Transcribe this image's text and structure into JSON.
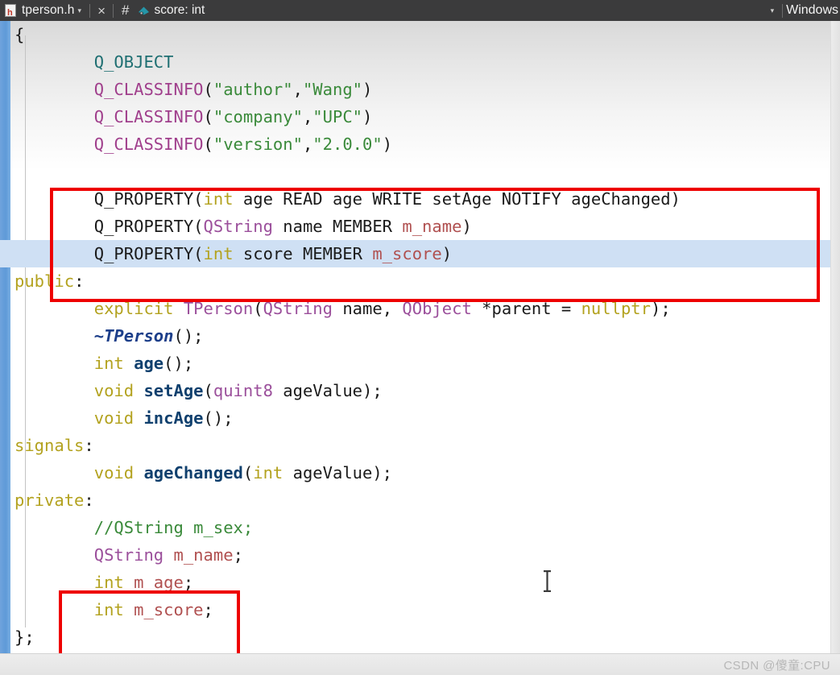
{
  "tabbar": {
    "file_icon": "header-file-icon",
    "file_name": "tperson.h",
    "caret": "▾",
    "close": "×",
    "hash": "#",
    "symbol_icon": "member-variable-icon",
    "symbol_label": "score: int",
    "right_caret": "▾",
    "right_label": "Windows"
  },
  "colors": {
    "tabbar_bg": "#3b3b3c",
    "highlight_line": "#cfe0f4",
    "annotation_red": "#ee0000",
    "gutter_blue": "#5e9ad8",
    "keyword": "#b3a21f",
    "type": "#9b4f9b",
    "macro": "#a03f8c",
    "qobject": "#1f6f72",
    "string": "#3a8a3a",
    "comment": "#3a8a3a",
    "function": "#10406e",
    "member": "#b05050",
    "watermark": "#b7b7b7"
  },
  "code": {
    "language": "C++ header",
    "lines": [
      {
        "n": 1,
        "highlight": false,
        "indent": 0,
        "tokens": [
          {
            "t": "{",
            "c": "plain"
          }
        ]
      },
      {
        "n": 2,
        "highlight": false,
        "indent": 4,
        "tokens": [
          {
            "t": "Q_OBJECT",
            "c": "qobj"
          }
        ]
      },
      {
        "n": 3,
        "highlight": false,
        "indent": 4,
        "tokens": [
          {
            "t": "Q_CLASSINFO",
            "c": "macro"
          },
          {
            "t": "(",
            "c": "plain"
          },
          {
            "t": "\"author\"",
            "c": "str"
          },
          {
            "t": ",",
            "c": "plain"
          },
          {
            "t": "\"Wang\"",
            "c": "str"
          },
          {
            "t": ")",
            "c": "plain"
          }
        ]
      },
      {
        "n": 4,
        "highlight": false,
        "indent": 4,
        "tokens": [
          {
            "t": "Q_CLASSINFO",
            "c": "macro"
          },
          {
            "t": "(",
            "c": "plain"
          },
          {
            "t": "\"company\"",
            "c": "str"
          },
          {
            "t": ",",
            "c": "plain"
          },
          {
            "t": "\"UPC\"",
            "c": "str"
          },
          {
            "t": ")",
            "c": "plain"
          }
        ]
      },
      {
        "n": 5,
        "highlight": false,
        "indent": 4,
        "tokens": [
          {
            "t": "Q_CLASSINFO",
            "c": "macro"
          },
          {
            "t": "(",
            "c": "plain"
          },
          {
            "t": "\"version\"",
            "c": "str"
          },
          {
            "t": ",",
            "c": "plain"
          },
          {
            "t": "\"2.0.0\"",
            "c": "str"
          },
          {
            "t": ")",
            "c": "plain"
          }
        ]
      },
      {
        "n": 6,
        "highlight": false,
        "indent": 0,
        "tokens": []
      },
      {
        "n": 7,
        "highlight": false,
        "indent": 4,
        "tokens": [
          {
            "t": "Q_PROPERTY",
            "c": "plain"
          },
          {
            "t": "(",
            "c": "plain"
          },
          {
            "t": "int",
            "c": "kw"
          },
          {
            "t": " age READ age WRITE setAge NOTIFY ageChanged",
            "c": "plain"
          },
          {
            "t": ")",
            "c": "plain"
          }
        ]
      },
      {
        "n": 8,
        "highlight": false,
        "indent": 4,
        "tokens": [
          {
            "t": "Q_PROPERTY",
            "c": "plain"
          },
          {
            "t": "(",
            "c": "plain"
          },
          {
            "t": "QString",
            "c": "type"
          },
          {
            "t": " name MEMBER ",
            "c": "plain"
          },
          {
            "t": "m_name",
            "c": "mem"
          },
          {
            "t": ")",
            "c": "plain"
          }
        ]
      },
      {
        "n": 9,
        "highlight": true,
        "indent": 4,
        "tokens": [
          {
            "t": "Q_PROPERTY",
            "c": "plain"
          },
          {
            "t": "(",
            "c": "plain"
          },
          {
            "t": "int",
            "c": "kw"
          },
          {
            "t": " score MEMBER ",
            "c": "plain"
          },
          {
            "t": "m_score",
            "c": "mem"
          },
          {
            "t": ")",
            "c": "plain"
          }
        ]
      },
      {
        "n": 10,
        "highlight": false,
        "indent": 0,
        "tokens": [
          {
            "t": "public",
            "c": "kw"
          },
          {
            "t": ":",
            "c": "plain"
          }
        ]
      },
      {
        "n": 11,
        "highlight": false,
        "indent": 4,
        "tokens": [
          {
            "t": "explicit",
            "c": "kw"
          },
          {
            "t": " ",
            "c": "plain"
          },
          {
            "t": "TPerson",
            "c": "type"
          },
          {
            "t": "(",
            "c": "plain"
          },
          {
            "t": "QString",
            "c": "type"
          },
          {
            "t": " name, ",
            "c": "plain"
          },
          {
            "t": "QObject",
            "c": "type"
          },
          {
            "t": " *parent = ",
            "c": "plain"
          },
          {
            "t": "nullptr",
            "c": "kw"
          },
          {
            "t": ");",
            "c": "plain"
          }
        ]
      },
      {
        "n": 12,
        "highlight": false,
        "indent": 4,
        "tokens": [
          {
            "t": "~TPerson",
            "c": "dtor"
          },
          {
            "t": "();",
            "c": "plain"
          }
        ]
      },
      {
        "n": 13,
        "highlight": false,
        "indent": 4,
        "tokens": [
          {
            "t": "int",
            "c": "kw"
          },
          {
            "t": " ",
            "c": "plain"
          },
          {
            "t": "age",
            "c": "fn"
          },
          {
            "t": "();",
            "c": "plain"
          }
        ]
      },
      {
        "n": 14,
        "highlight": false,
        "indent": 4,
        "tokens": [
          {
            "t": "void",
            "c": "kw"
          },
          {
            "t": " ",
            "c": "plain"
          },
          {
            "t": "setAge",
            "c": "fn"
          },
          {
            "t": "(",
            "c": "plain"
          },
          {
            "t": "quint8",
            "c": "type"
          },
          {
            "t": " ageValue);",
            "c": "plain"
          }
        ]
      },
      {
        "n": 15,
        "highlight": false,
        "indent": 4,
        "tokens": [
          {
            "t": "void",
            "c": "kw"
          },
          {
            "t": " ",
            "c": "plain"
          },
          {
            "t": "incAge",
            "c": "fn"
          },
          {
            "t": "();",
            "c": "plain"
          }
        ]
      },
      {
        "n": 16,
        "highlight": false,
        "indent": 0,
        "tokens": [
          {
            "t": "signals",
            "c": "kw"
          },
          {
            "t": ":",
            "c": "plain"
          }
        ]
      },
      {
        "n": 17,
        "highlight": false,
        "indent": 4,
        "tokens": [
          {
            "t": "void",
            "c": "kw"
          },
          {
            "t": " ",
            "c": "plain"
          },
          {
            "t": "ageChanged",
            "c": "fn"
          },
          {
            "t": "(",
            "c": "plain"
          },
          {
            "t": "int",
            "c": "kw"
          },
          {
            "t": " ageValue);",
            "c": "plain"
          }
        ]
      },
      {
        "n": 18,
        "highlight": false,
        "indent": 0,
        "tokens": [
          {
            "t": "private",
            "c": "kw"
          },
          {
            "t": ":",
            "c": "plain"
          }
        ]
      },
      {
        "n": 19,
        "highlight": false,
        "indent": 4,
        "tokens": [
          {
            "t": "//QString m_sex;",
            "c": "cmt"
          }
        ]
      },
      {
        "n": 20,
        "highlight": false,
        "indent": 4,
        "tokens": [
          {
            "t": "QString",
            "c": "type"
          },
          {
            "t": " ",
            "c": "plain"
          },
          {
            "t": "m_name",
            "c": "mem"
          },
          {
            "t": ";",
            "c": "plain"
          }
        ]
      },
      {
        "n": 21,
        "highlight": false,
        "indent": 4,
        "tokens": [
          {
            "t": "int",
            "c": "kw"
          },
          {
            "t": " ",
            "c": "plain"
          },
          {
            "t": "m_age",
            "c": "mem"
          },
          {
            "t": ";",
            "c": "plain"
          }
        ]
      },
      {
        "n": 22,
        "highlight": false,
        "indent": 4,
        "tokens": [
          {
            "t": "int",
            "c": "kw"
          },
          {
            "t": " ",
            "c": "plain"
          },
          {
            "t": "m_score",
            "c": "mem"
          },
          {
            "t": ";",
            "c": "plain"
          }
        ]
      },
      {
        "n": 23,
        "highlight": false,
        "indent": 0,
        "tokens": [
          {
            "t": "};",
            "c": "plain"
          }
        ]
      }
    ]
  },
  "annotations": [
    {
      "name": "q-property-block-box",
      "label": ""
    },
    {
      "name": "member-variables-box",
      "label": ""
    }
  ],
  "watermark": {
    "text": "CSDN @傻童:CPU"
  }
}
